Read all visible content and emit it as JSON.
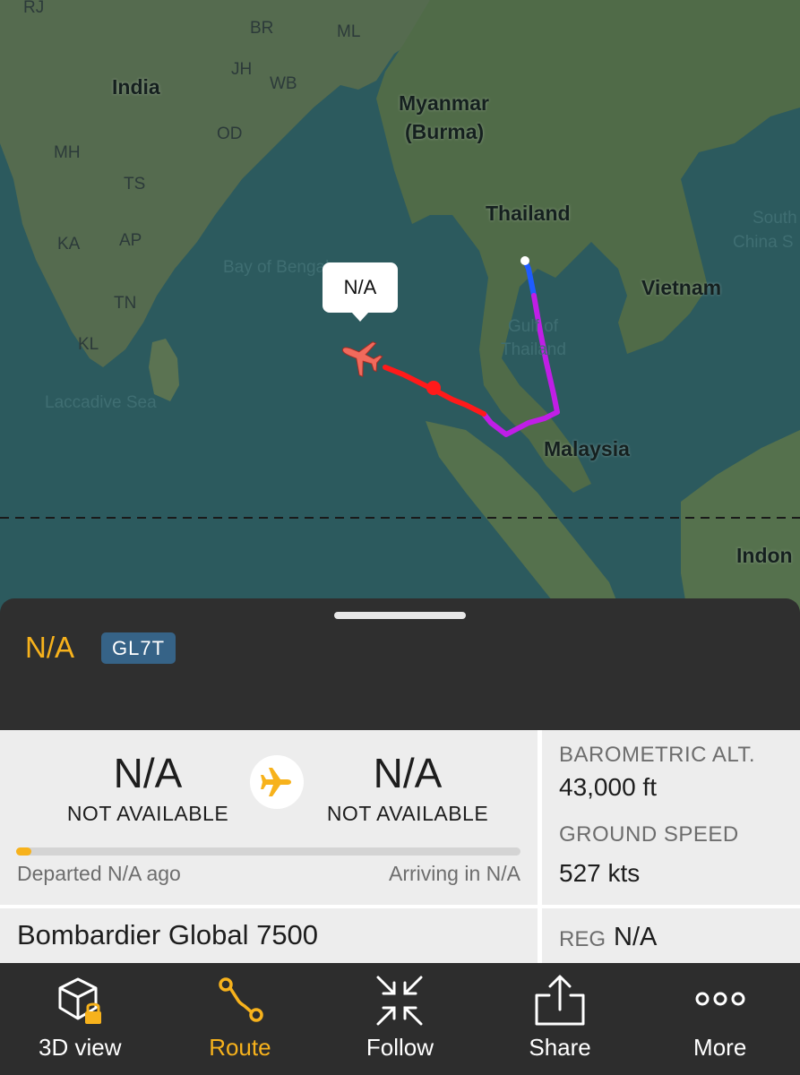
{
  "map": {
    "callout": "N/A",
    "labels": {
      "rj": "RJ",
      "br": "BR",
      "ml": "ML",
      "jh": "JH",
      "wb": "WB",
      "india": "India",
      "od": "OD",
      "mh": "MH",
      "ts": "TS",
      "ka": "KA",
      "ap": "AP",
      "tn": "TN",
      "kl": "KL",
      "myanmar": "Myanmar",
      "burma": "(Burma)",
      "thailand": "Thailand",
      "vietnam": "Vietnam",
      "malaysia": "Malaysia",
      "south": "South",
      "china_sea": "China S",
      "bay_of_bengal": "Bay of Bengal",
      "gulf_of": "Gulf of",
      "thailand_gulf": "Thailand",
      "laccadive": "Laccadive Sea",
      "indonesia": "Indon"
    }
  },
  "flight": {
    "callsign": "N/A",
    "aircraft_type_code": "GL7T"
  },
  "route": {
    "origin_code": "N/A",
    "origin_name": "NOT AVAILABLE",
    "destination_code": "N/A",
    "destination_name": "NOT AVAILABLE",
    "progress": 0.03,
    "departed": "Departed N/A ago",
    "arriving": "Arriving in N/A"
  },
  "stats": {
    "baro_label": "BAROMETRIC ALT.",
    "baro_value": "43,000 ft",
    "speed_label": "GROUND SPEED",
    "speed_value": "527 kts"
  },
  "aircraft": {
    "name": "Bombardier Global 7500",
    "reg_label": "REG",
    "reg_value": "N/A"
  },
  "toolbar": {
    "items": [
      {
        "label": "3D view",
        "icon": "cube-lock-icon",
        "active": false
      },
      {
        "label": "Route",
        "icon": "route-icon",
        "active": true
      },
      {
        "label": "Follow",
        "icon": "follow-arrows-icon",
        "active": false
      },
      {
        "label": "Share",
        "icon": "share-icon",
        "active": false
      },
      {
        "label": "More",
        "icon": "more-dots-icon",
        "active": false
      }
    ]
  },
  "colors": {
    "accent": "#f7b21c",
    "badge": "#366387",
    "track_red": "#ff1a1a",
    "track_purple": "#c01ee6",
    "track_blue": "#1e5cff"
  }
}
